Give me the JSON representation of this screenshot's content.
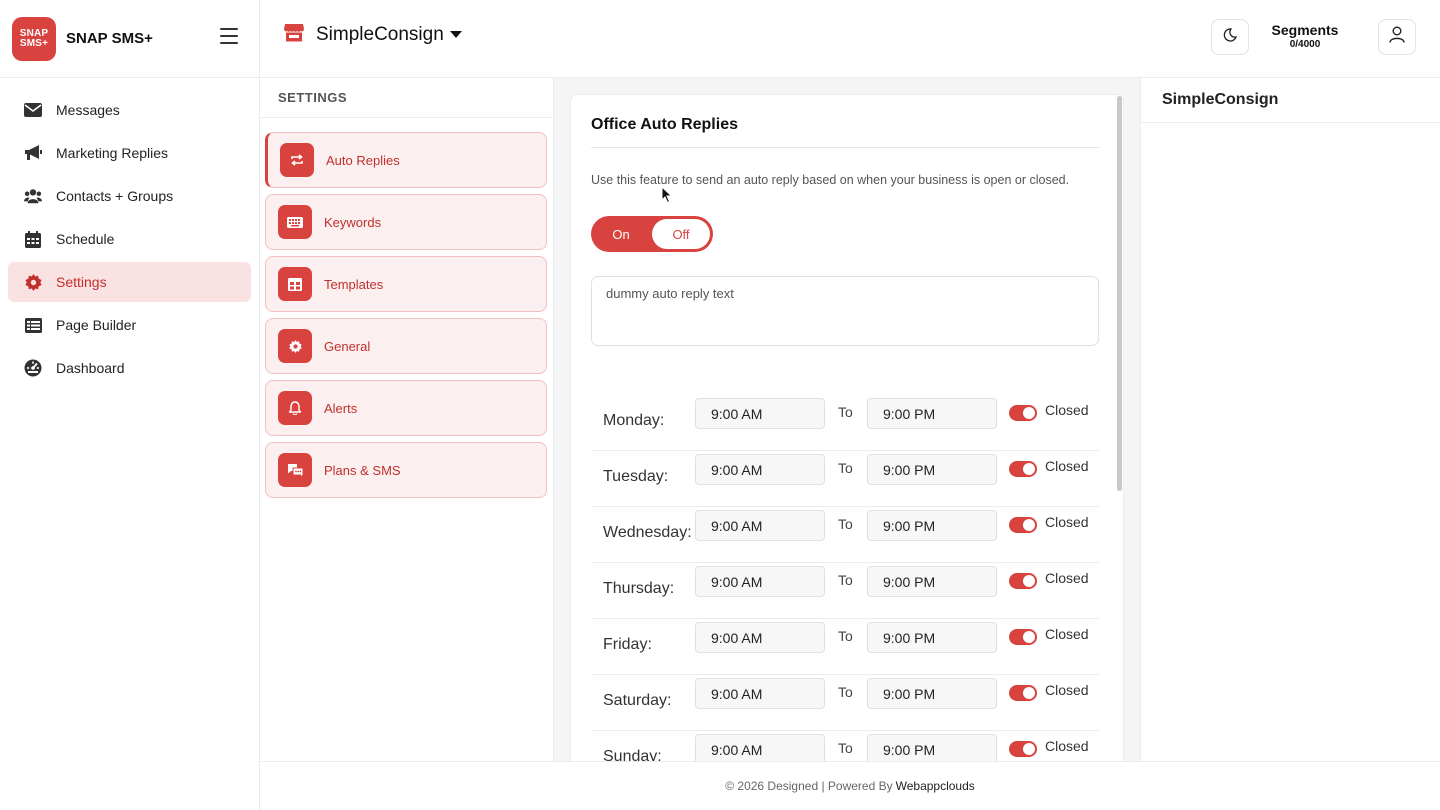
{
  "brand": {
    "logo_line1": "SNAP",
    "logo_line2": "SMS+",
    "name": "SNAP SMS+"
  },
  "sidebar": {
    "items": [
      {
        "label": "Messages",
        "icon": "envelope-icon"
      },
      {
        "label": "Marketing Replies",
        "icon": "megaphone-icon"
      },
      {
        "label": "Contacts + Groups",
        "icon": "users-icon"
      },
      {
        "label": "Schedule",
        "icon": "calendar-icon"
      },
      {
        "label": "Settings",
        "icon": "gear-icon",
        "active": true
      },
      {
        "label": "Page Builder",
        "icon": "table-icon"
      },
      {
        "label": "Dashboard",
        "icon": "gauge-icon"
      }
    ]
  },
  "header": {
    "store_name": "SimpleConsign",
    "segments_title": "Segments",
    "segments_count": "0/4000"
  },
  "settings": {
    "heading": "SETTINGS",
    "items": [
      {
        "label": "Auto Replies",
        "icon": "repeat-icon",
        "active": true
      },
      {
        "label": "Keywords",
        "icon": "keyboard-icon"
      },
      {
        "label": "Templates",
        "icon": "grid-icon"
      },
      {
        "label": "General",
        "icon": "gear-icon"
      },
      {
        "label": "Alerts",
        "icon": "bell-icon"
      },
      {
        "label": "Plans & SMS",
        "icon": "chat-icon"
      }
    ]
  },
  "auto_replies": {
    "title": "Office Auto Replies",
    "description": "Use this feature to send an auto reply based on when your business is open or closed.",
    "toggle_on": "On",
    "toggle_off": "Off",
    "reply_text": "dummy auto reply text",
    "to_label": "To",
    "closed_label": "Closed",
    "days": [
      {
        "day": "Monday:",
        "from": "9:00 AM",
        "to": "9:00 PM"
      },
      {
        "day": "Tuesday:",
        "from": "9:00 AM",
        "to": "9:00 PM"
      },
      {
        "day": "Wednesday:",
        "from": "9:00 AM",
        "to": "9:00 PM"
      },
      {
        "day": "Thursday:",
        "from": "9:00 AM",
        "to": "9:00 PM"
      },
      {
        "day": "Friday:",
        "from": "9:00 AM",
        "to": "9:00 PM"
      },
      {
        "day": "Saturday:",
        "from": "9:00 AM",
        "to": "9:00 PM"
      },
      {
        "day": "Sunday:",
        "from": "9:00 AM",
        "to": "9:00 PM"
      }
    ]
  },
  "right_panel": {
    "title": "SimpleConsign"
  },
  "footer": {
    "text": "© 2026 Designed | Powered By",
    "link": "Webappclouds"
  },
  "colors": {
    "accent": "#d9433f",
    "accent_light": "#fcefef",
    "active_nav": "#fbe2e2"
  }
}
